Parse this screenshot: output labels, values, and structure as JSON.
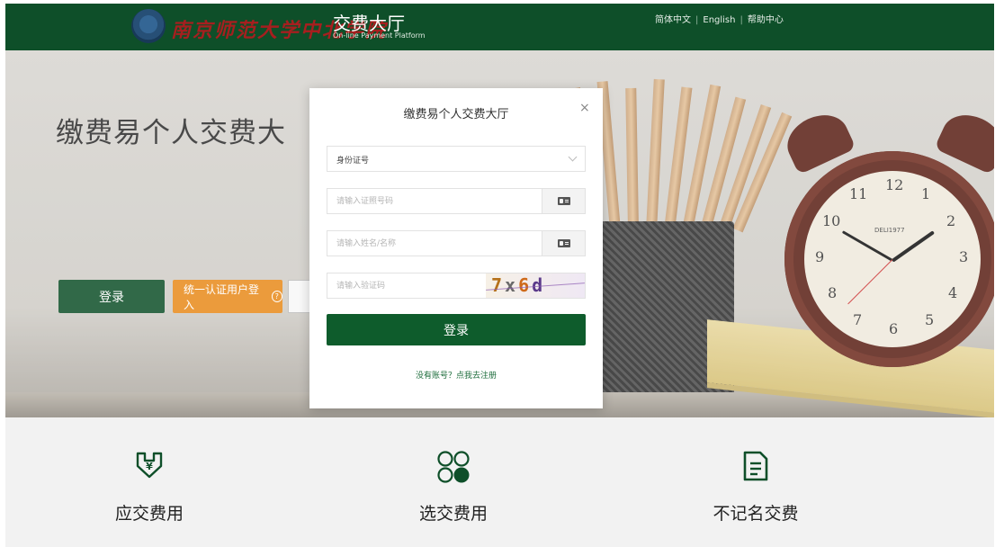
{
  "header": {
    "school_name": "南京师范大学中北学院",
    "platform_title": "交费大厅",
    "platform_subtitle": "On-line Payment Platform",
    "links": [
      "简体中文",
      "English",
      "帮助中心"
    ]
  },
  "hero": {
    "title": "缴费易个人交费大",
    "login_button": "登录",
    "unified_login_button": "统一认证用户登入",
    "clock_brand": "DELI1977"
  },
  "modal": {
    "title": "缴费易个人交费大厅",
    "close_icon": "×",
    "id_type_selected": "身份证号",
    "id_number_placeholder": "请输入证照号码",
    "name_placeholder": "请输入姓名/名称",
    "captcha_placeholder": "请输入验证码",
    "captcha_chars": [
      "7",
      "x",
      "6",
      "d"
    ],
    "submit_label": "登录",
    "register_link": "没有账号？点我去注册"
  },
  "features": [
    {
      "label": "应交费用",
      "icon": "yen-shield-icon"
    },
    {
      "label": "选交费用",
      "icon": "circles-grid-icon"
    },
    {
      "label": "不记名交费",
      "icon": "document-icon"
    }
  ],
  "colors": {
    "primary_green": "#0e4f29",
    "orange": "#e88a1a",
    "school_red": "#a61f1f"
  }
}
